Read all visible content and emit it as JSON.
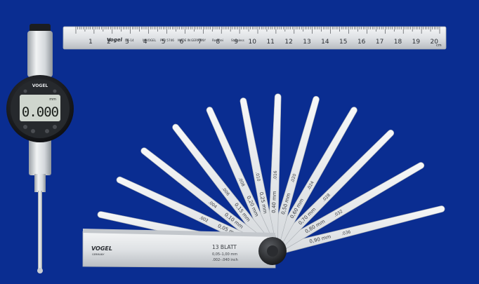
{
  "colors": {
    "background": "#0a2d91",
    "steel_light": "#eef0f2",
    "steel_mid": "#c9cdd2",
    "steel_dark": "#8c9197",
    "gauge_body": "#1b1d20",
    "lcd_bg": "#cfd6ce",
    "lcd_text": "#1a1f1b",
    "marking": "#2b2e33"
  },
  "dial_indicator": {
    "brand": "VOGEL",
    "display_value": "0.000",
    "unit": "mm"
  },
  "ruler": {
    "brand": "Vogel",
    "numbers": [
      "1",
      "2",
      "3",
      "4",
      "5",
      "6",
      "7",
      "8",
      "9",
      "10",
      "11",
      "12",
      "13",
      "14",
      "15",
      "16",
      "17",
      "18",
      "19",
      "20"
    ],
    "unit": "cm",
    "markings": [
      "DE-14",
      "MIVOGEL",
      "PTB 5746",
      "MADE IN",
      "GERMANY",
      "Rostfrei",
      "Stainless"
    ]
  },
  "feeler_gauge": {
    "brand": "VOGEL",
    "brand_sub": "GERMANY",
    "count_label": "13 BLATT",
    "range_label": "0,05–1,00 mm",
    "inch_label": ".002–.040 inch",
    "blades": [
      {
        "label": "1,00 mm",
        "sub": ".040"
      },
      {
        "label": "0,05 mm",
        "sub": ".002"
      },
      {
        "label": "0,10 mm",
        "sub": ".004"
      },
      {
        "label": "0,15 mm",
        "sub": ".006"
      },
      {
        "label": "0,20 mm",
        "sub": ".008"
      },
      {
        "label": "0,25 mm",
        "sub": ".010"
      },
      {
        "label": "0,40 mm",
        "sub": ".016"
      },
      {
        "label": "0,50 mm",
        "sub": ".020"
      },
      {
        "label": "0,60 mm",
        "sub": ".024"
      },
      {
        "label": "0,70 mm",
        "sub": ".028"
      },
      {
        "label": "0,80 mm",
        "sub": ".032"
      },
      {
        "label": "0,90 mm",
        "sub": ".036"
      }
    ]
  }
}
